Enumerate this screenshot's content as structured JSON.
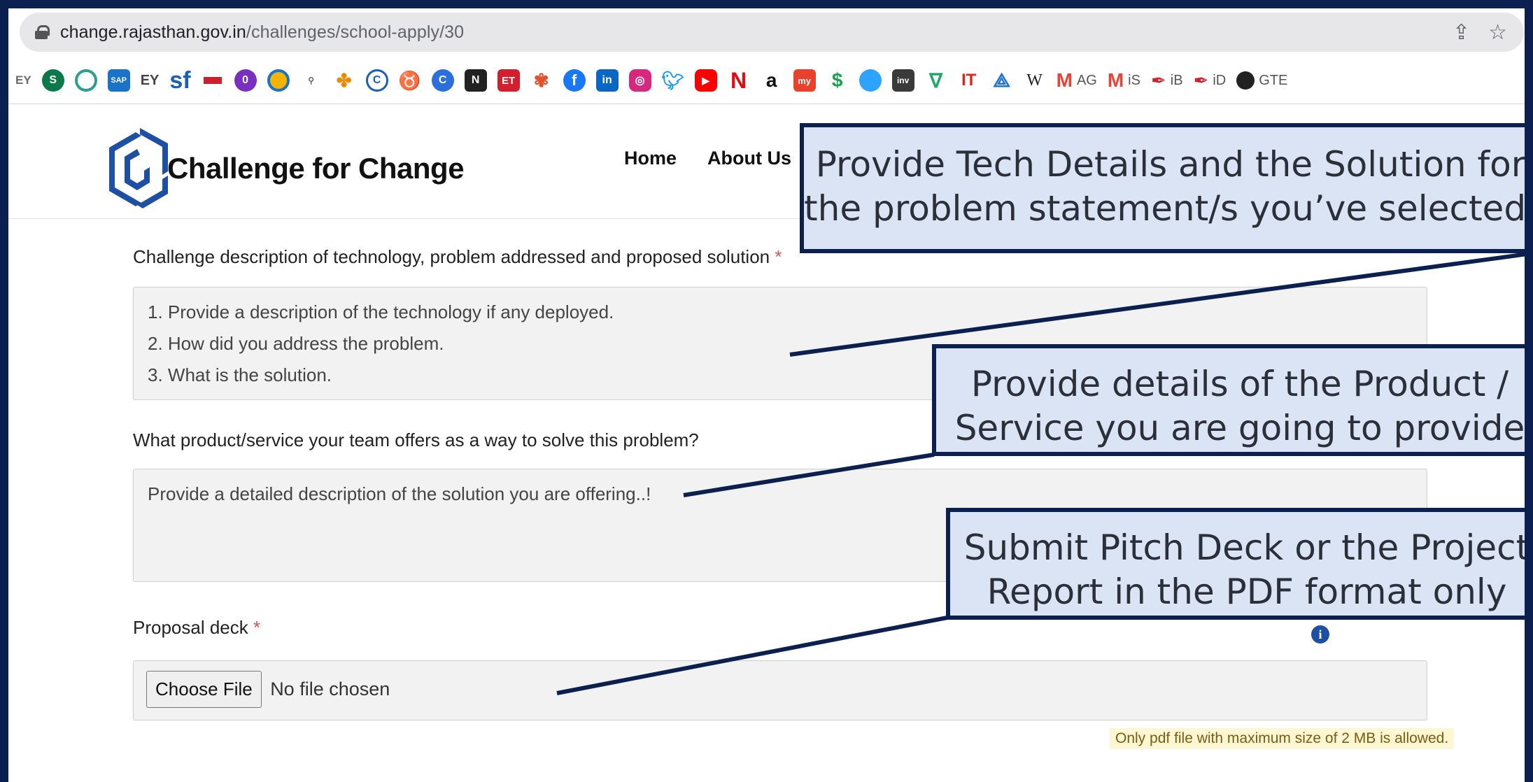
{
  "browser": {
    "url_host": "change.rajasthan.gov.in",
    "url_path": "/challenges/school-apply/30",
    "bookmarks": [
      {
        "label": "",
        "icon": "ey-logo-icon"
      },
      {
        "label": "",
        "icon": "sharepoint-icon"
      },
      {
        "label": "",
        "icon": "circle-app-icon"
      },
      {
        "label": "",
        "icon": "sap-icon"
      },
      {
        "label": "EY",
        "icon": "ey-text-icon"
      },
      {
        "label": "sf",
        "icon": "successfactors-icon"
      },
      {
        "label": "",
        "icon": "bar-icon"
      },
      {
        "label": "",
        "icon": "purple-app-icon"
      },
      {
        "label": "",
        "icon": "yellow-circle-icon"
      },
      {
        "label": "",
        "icon": "start-icon"
      },
      {
        "label": "",
        "icon": "flower-icon"
      },
      {
        "label": "",
        "icon": "logo-c-icon"
      },
      {
        "label": "",
        "icon": "cup-icon"
      },
      {
        "label": "",
        "icon": "c-circle-icon"
      },
      {
        "label": "",
        "icon": "news-icon"
      },
      {
        "label": "ET",
        "icon": "et-icon"
      },
      {
        "label": "",
        "icon": "cnbc-icon"
      },
      {
        "label": "",
        "icon": "facebook-icon"
      },
      {
        "label": "in",
        "icon": "linkedin-icon"
      },
      {
        "label": "",
        "icon": "instagram-icon"
      },
      {
        "label": "",
        "icon": "twitter-icon"
      },
      {
        "label": "",
        "icon": "youtube-icon"
      },
      {
        "label": "N",
        "icon": "netflix-icon"
      },
      {
        "label": "a",
        "icon": "amazon-icon"
      },
      {
        "label": "my",
        "icon": "myntra-icon"
      },
      {
        "label": "",
        "icon": "dollar-icon"
      },
      {
        "label": "",
        "icon": "blue-circle-icon"
      },
      {
        "label": "inv",
        "icon": "investing-icon"
      },
      {
        "label": "",
        "icon": "v-icon"
      },
      {
        "label": "IT",
        "icon": "it-icon"
      },
      {
        "label": "",
        "icon": "peak-icon"
      },
      {
        "label": "W",
        "icon": "wikipedia-icon"
      }
    ],
    "labeled_bookmarks": [
      {
        "label": "AG",
        "icon": "gmail-icon"
      },
      {
        "label": "iS",
        "icon": "gmail-icon"
      },
      {
        "label": "iB",
        "icon": "feather-icon"
      },
      {
        "label": "iD",
        "icon": "feather-icon"
      },
      {
        "label": "GTE",
        "icon": "github-icon"
      }
    ]
  },
  "header": {
    "brand": "Challenge for Change",
    "nav": [
      "Home",
      "About Us"
    ]
  },
  "form": {
    "field1": {
      "label": "Challenge description of technology, problem addressed and proposed solution",
      "required_mark": "*",
      "placeholder_lines": [
        "1. Provide a description of the technology if any deployed.",
        "2. How did you address the problem.",
        "3. What is the solution."
      ]
    },
    "field2": {
      "label": "What product/service your team offers as a way to solve this problem?",
      "placeholder": "Provide a detailed description of the solution you are offering..!"
    },
    "field3": {
      "label": "Proposal deck",
      "required_mark": "*",
      "button": "Choose File",
      "status": "No file chosen",
      "hint": "Only pdf file with maximum size of 2 MB is allowed.",
      "info": "i"
    }
  },
  "callouts": [
    {
      "lines": [
        "Provide Tech Details and the Solution for",
        "the problem statement/s you’ve selected."
      ]
    },
    {
      "lines": [
        "Provide details of the Product /",
        "Service you are going to provide"
      ]
    },
    {
      "lines": [
        "Submit Pitch Deck or the Project",
        "Report in the PDF format only"
      ]
    }
  ],
  "colors": {
    "frame": "#0c2050",
    "callout_fill": "#dbe4f4",
    "required": "#d9534f",
    "logo": "#1d4fa3"
  }
}
